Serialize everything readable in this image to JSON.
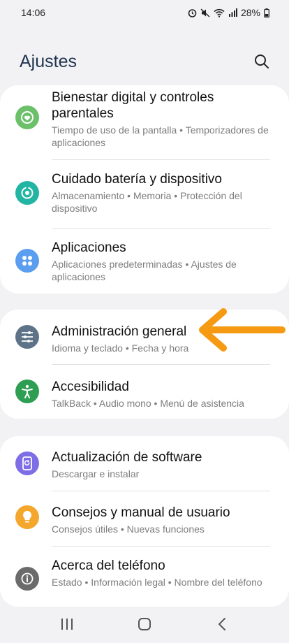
{
  "status_bar": {
    "time": "14:06",
    "battery": "28%"
  },
  "header": {
    "title": "Ajustes"
  },
  "groups": [
    {
      "items": [
        {
          "title": "Bienestar digital y controles parentales",
          "subtitle": "Tiempo de uso de la pantalla  •  Temporizadores de aplicaciones",
          "icon": "digital-wellbeing-icon",
          "color": "#6cc06a"
        },
        {
          "title": "Cuidado batería y dispositivo",
          "subtitle": "Almacenamiento  •  Memoria  •  Protección del dispositivo",
          "icon": "device-care-icon",
          "color": "#22b5a3"
        },
        {
          "title": "Aplicaciones",
          "subtitle": "Aplicaciones predeterminadas  •  Ajustes de aplicaciones",
          "icon": "apps-icon",
          "color": "#5b9ef0"
        }
      ]
    },
    {
      "items": [
        {
          "title": "Administración general",
          "subtitle": "Idioma y teclado  •  Fecha y hora",
          "icon": "sliders-icon",
          "color": "#5f7388"
        },
        {
          "title": "Accesibilidad",
          "subtitle": "TalkBack  •  Audio mono  •  Menú de asistencia",
          "icon": "accessibility-icon",
          "color": "#2e9e52"
        }
      ]
    },
    {
      "items": [
        {
          "title": "Actualización de software",
          "subtitle": "Descargar e instalar",
          "icon": "software-update-icon",
          "color": "#7d6ee6"
        },
        {
          "title": "Consejos y manual de usuario",
          "subtitle": "Consejos útiles  •  Nuevas funciones",
          "icon": "lightbulb-icon",
          "color": "#f4a72c"
        },
        {
          "title": "Acerca del teléfono",
          "subtitle": "Estado  •  Información legal  •  Nombre del teléfono",
          "icon": "info-icon",
          "color": "#6b6b6b"
        }
      ]
    }
  ],
  "annotation": {
    "arrow_color": "#f59a12"
  }
}
